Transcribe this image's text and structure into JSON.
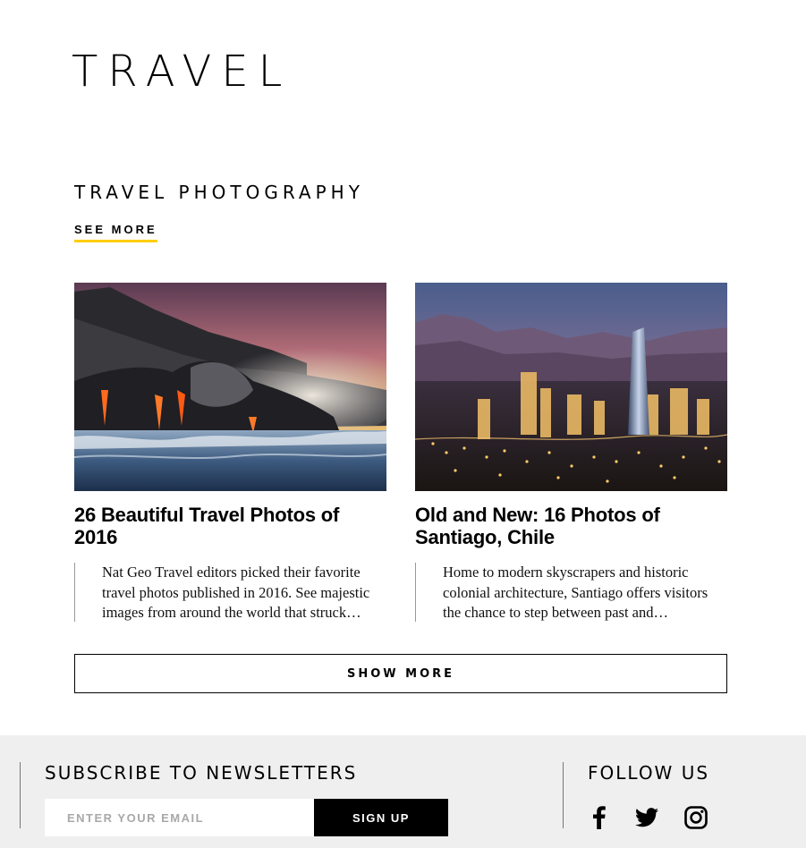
{
  "header": {
    "brand": "TRAVEL"
  },
  "section": {
    "title": "TRAVEL PHOTOGRAPHY",
    "see_more": "SEE MORE",
    "accent_color": "#ffce00"
  },
  "cards": [
    {
      "title": "26 Beautiful Travel Photos of 2016",
      "description": "Nat Geo Travel editors picked their favorite travel photos published in 2016. See majestic images from around the world that struck…"
    },
    {
      "title": "Old and New: 16 Photos of Santiago, Chile",
      "description": "Home to modern skyscrapers and historic colonial architecture, Santiago offers visitors the chance to step between past and…"
    }
  ],
  "show_more": "SHOW MORE",
  "footer": {
    "subscribe_title": "SUBSCRIBE TO NEWSLETTERS",
    "email_placeholder": "ENTER YOUR EMAIL",
    "signup_label": "SIGN UP",
    "follow_title": "FOLLOW US",
    "social": [
      "facebook-icon",
      "twitter-icon",
      "instagram-icon"
    ]
  }
}
